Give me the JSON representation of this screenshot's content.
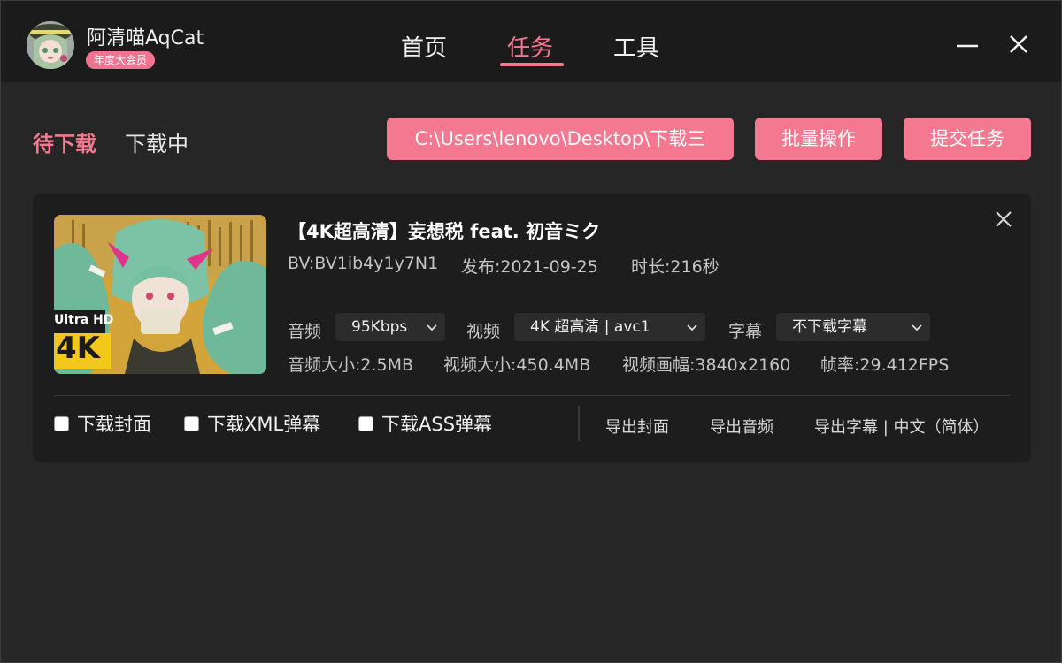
{
  "app": {
    "name": "阿清喵AqCat",
    "member_badge": "年度大会员"
  },
  "nav": {
    "tabs": [
      {
        "label": "首页",
        "active": false
      },
      {
        "label": "任务",
        "active": true
      },
      {
        "label": "工具",
        "active": false
      }
    ]
  },
  "window_controls": {
    "minimize_icon": "minimize-icon",
    "close_icon": "close-icon"
  },
  "subtabs": [
    {
      "label": "待下载",
      "active": true
    },
    {
      "label": "下载中",
      "active": false
    }
  ],
  "toolbar": {
    "path_label": "C:\\Users\\lenovo\\Desktop\\下载三",
    "batch_label": "批量操作",
    "submit_label": "提交任务"
  },
  "task": {
    "title": "【4K超高清】妄想税 feat. 初音ミク",
    "thumbnail_badge_top": "Ultra HD",
    "thumbnail_badge_bottom": "4K",
    "bv": "BV:BV1ib4y1y7N1",
    "published": "发布:2021-09-25",
    "duration": "时长:216秒",
    "audio": {
      "label": "音频",
      "selected": "95Kbps"
    },
    "video": {
      "label": "视频",
      "selected": "4K 超高清 | avc1"
    },
    "subtitle": {
      "label": "字幕",
      "selected": "不下载字幕"
    },
    "audio_size": "音频大小:2.5MB",
    "video_size": "视频大小:450.4MB",
    "resolution": "视频画幅:3840x2160",
    "framerate": "帧率:29.412FPS",
    "checkboxes": [
      {
        "label": "下载封面",
        "checked": false
      },
      {
        "label": "下载XML弹幕",
        "checked": false
      },
      {
        "label": "下载ASS弹幕",
        "checked": false
      }
    ],
    "exports": {
      "cover": "导出封面",
      "audio": "导出音频",
      "subtitle": "导出字幕 | 中文（简体）"
    }
  },
  "colors": {
    "accent": "#f4788f",
    "background": "#262626",
    "titlebar": "#1b1b1b",
    "card": "#1d1d1d"
  }
}
